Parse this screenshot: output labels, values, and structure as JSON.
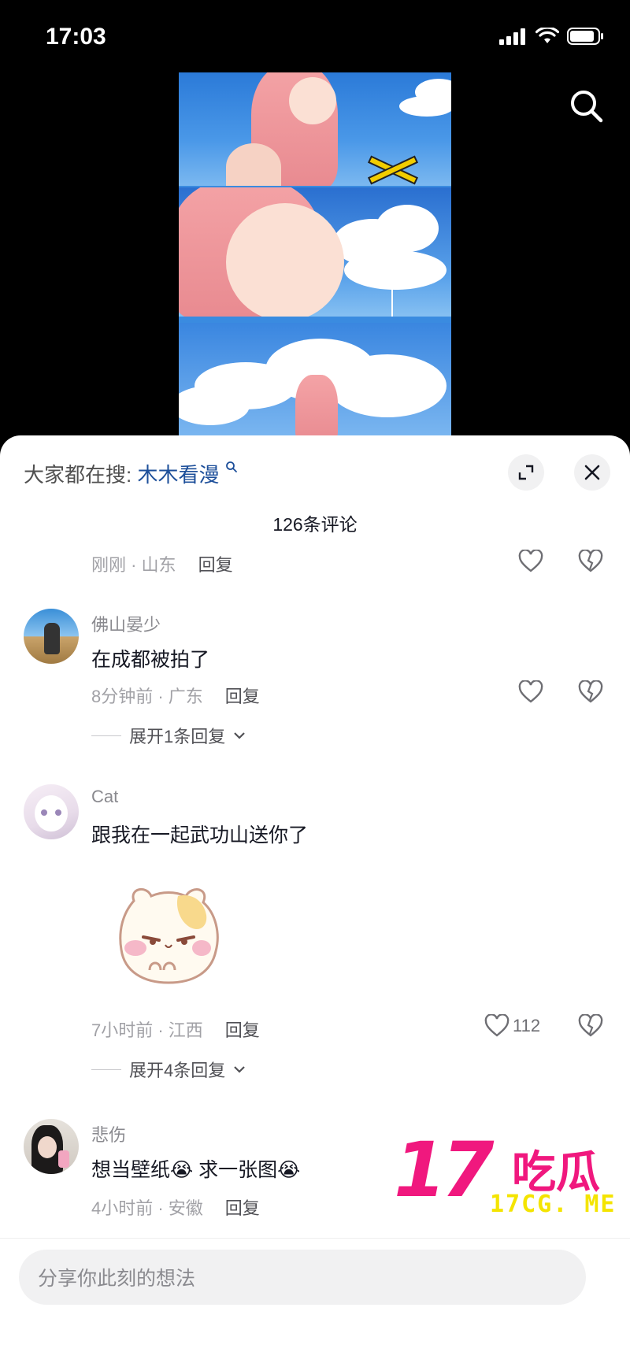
{
  "status": {
    "time": "17:03"
  },
  "sheet": {
    "trending_prefix": "大家都在搜:",
    "trending_keyword": "木木看漫",
    "comment_count": "126条评论"
  },
  "partial_comment": {
    "time_location": "刚刚 · 山东",
    "reply": "回复"
  },
  "comments": [
    {
      "name": "佛山晏少",
      "text": "在成都被拍了",
      "time_location": "8分钟前 · 广东",
      "reply": "回复",
      "expand_replies": "展开1条回复"
    },
    {
      "name": "Cat",
      "text": "跟我在一起武功山送你了",
      "time_location": "7小时前 · 江西",
      "reply": "回复",
      "likes": "112",
      "expand_replies": "展开4条回复"
    },
    {
      "name": "悲伤",
      "text": "想当壁纸😭 求一张图😭",
      "time_location": "4小时前 · 安徽",
      "reply": "回复"
    }
  ],
  "input": {
    "placeholder": "分享你此刻的想法"
  },
  "watermark": {
    "number": "17",
    "chinese": "吃瓜",
    "url": "17CG. ME"
  },
  "colors": {
    "accent_link": "#1d4f9a",
    "watermark_pink": "#f0187e",
    "watermark_yellow": "#f4e400"
  }
}
